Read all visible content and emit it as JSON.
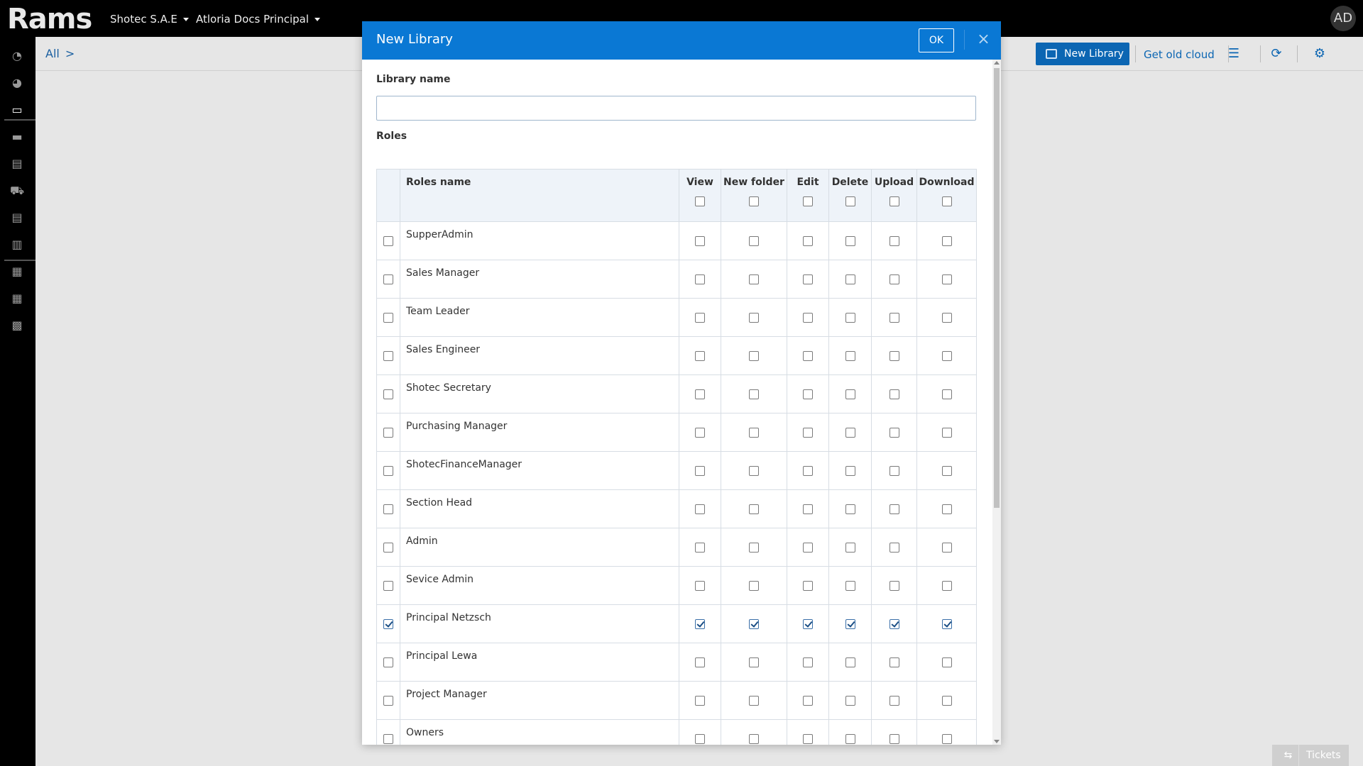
{
  "app": {
    "logo_text": "Rams"
  },
  "topbar": {
    "company": "Shotec S.A.E",
    "docs": "Atloria Docs Principal",
    "avatar": "AD"
  },
  "sidebar": {
    "icons": [
      "dashboard-icon",
      "dashboard-icon",
      "monitor-icon",
      "briefcase-icon",
      "report-icon",
      "cart-icon",
      "report-icon",
      "invoice-icon",
      "checklist-icon",
      "checklist-icon",
      "grid-icon"
    ]
  },
  "subbar": {
    "breadcrumb": "All",
    "breadcrumb_sep": ">",
    "new_library_label": "New Library",
    "get_old_cloud_label": "Get old cloud"
  },
  "tickets": {
    "label": "Tickets"
  },
  "modal": {
    "title": "New Library",
    "ok_label": "OK",
    "close_label": "×",
    "library_name_label": "Library name",
    "library_name_value": "",
    "roles_label": "Roles",
    "columns": [
      "Roles name",
      "View",
      "New folder",
      "Edit",
      "Delete",
      "Upload",
      "Download"
    ],
    "rows": [
      {
        "name": "SupperAdmin",
        "checked": false
      },
      {
        "name": "Sales Manager",
        "checked": false
      },
      {
        "name": "Team Leader",
        "checked": false
      },
      {
        "name": "Sales Engineer",
        "checked": false
      },
      {
        "name": "Shotec Secretary",
        "checked": false
      },
      {
        "name": "Purchasing Manager",
        "checked": false
      },
      {
        "name": "ShotecFinanceManager",
        "checked": false
      },
      {
        "name": "Section Head",
        "checked": false
      },
      {
        "name": "Admin",
        "checked": false
      },
      {
        "name": "Sevice Admin",
        "checked": false
      },
      {
        "name": "Principal Netzsch",
        "checked": true
      },
      {
        "name": "Principal Lewa",
        "checked": false
      },
      {
        "name": "Project Manager",
        "checked": false
      },
      {
        "name": "Owners",
        "checked": false
      }
    ]
  },
  "colors": {
    "primary": "#0a78d4",
    "button": "#0c66b3",
    "topbar": "#000000"
  }
}
